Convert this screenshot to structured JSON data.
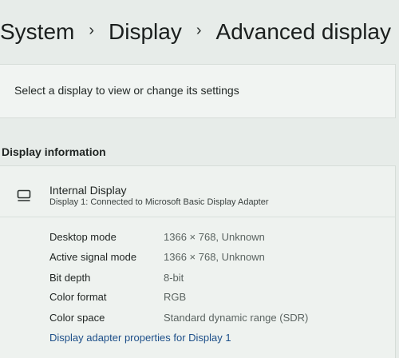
{
  "breadcrumb": {
    "items": [
      "System",
      "Display",
      "Advanced display"
    ],
    "separator": "›"
  },
  "selector": {
    "text": "Select a display to view or change its settings"
  },
  "display_information": {
    "heading": "Display information",
    "display_name": "Internal Display",
    "display_description": "Display 1: Connected to Microsoft Basic Display Adapter",
    "icon": "monitor-icon",
    "specs": [
      {
        "label": "Desktop mode",
        "value": "1366 × 768, Unknown"
      },
      {
        "label": "Active signal mode",
        "value": "1366 × 768, Unknown"
      },
      {
        "label": "Bit depth",
        "value": "8-bit"
      },
      {
        "label": "Color format",
        "value": "RGB"
      },
      {
        "label": "Color space",
        "value": "Standard dynamic range (SDR)"
      }
    ],
    "adapter_link": "Display adapter properties for Display 1"
  },
  "colors": {
    "background": "#e7ece9",
    "link": "#1d4f89"
  }
}
